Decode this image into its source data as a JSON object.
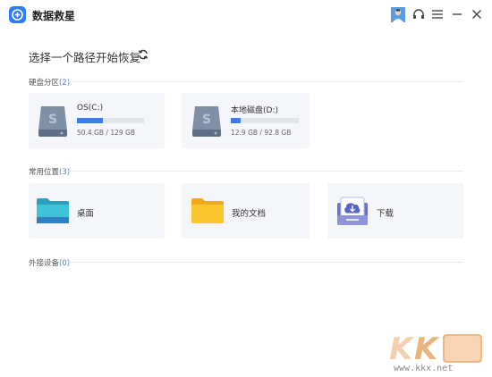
{
  "app": {
    "title": "数据救星"
  },
  "heading": "选择一个路径开始恢复",
  "sections": {
    "partitions": {
      "label": "硬盘分区",
      "count": "(2)"
    },
    "common": {
      "label": "常用位置",
      "count": "(3)"
    },
    "external": {
      "label": "外接设备",
      "count": "(0)"
    }
  },
  "drives": [
    {
      "label": "OS(C:)",
      "size": "50.4 GB / 129 GB",
      "used_fraction": 0.39
    },
    {
      "label": "本地磁盘(D:)",
      "size": "12.9 GB / 92.8 GB",
      "used_fraction": 0.14
    }
  ],
  "folders": [
    {
      "label": "桌面",
      "icon": "desktop-folder-icon"
    },
    {
      "label": "我的文档",
      "icon": "documents-folder-icon"
    },
    {
      "label": "下载",
      "icon": "download-icon"
    }
  ],
  "watermark": {
    "text": "www.kkx.net"
  },
  "colors": {
    "accent": "#3d7be8",
    "card": "#f4f6f9"
  }
}
